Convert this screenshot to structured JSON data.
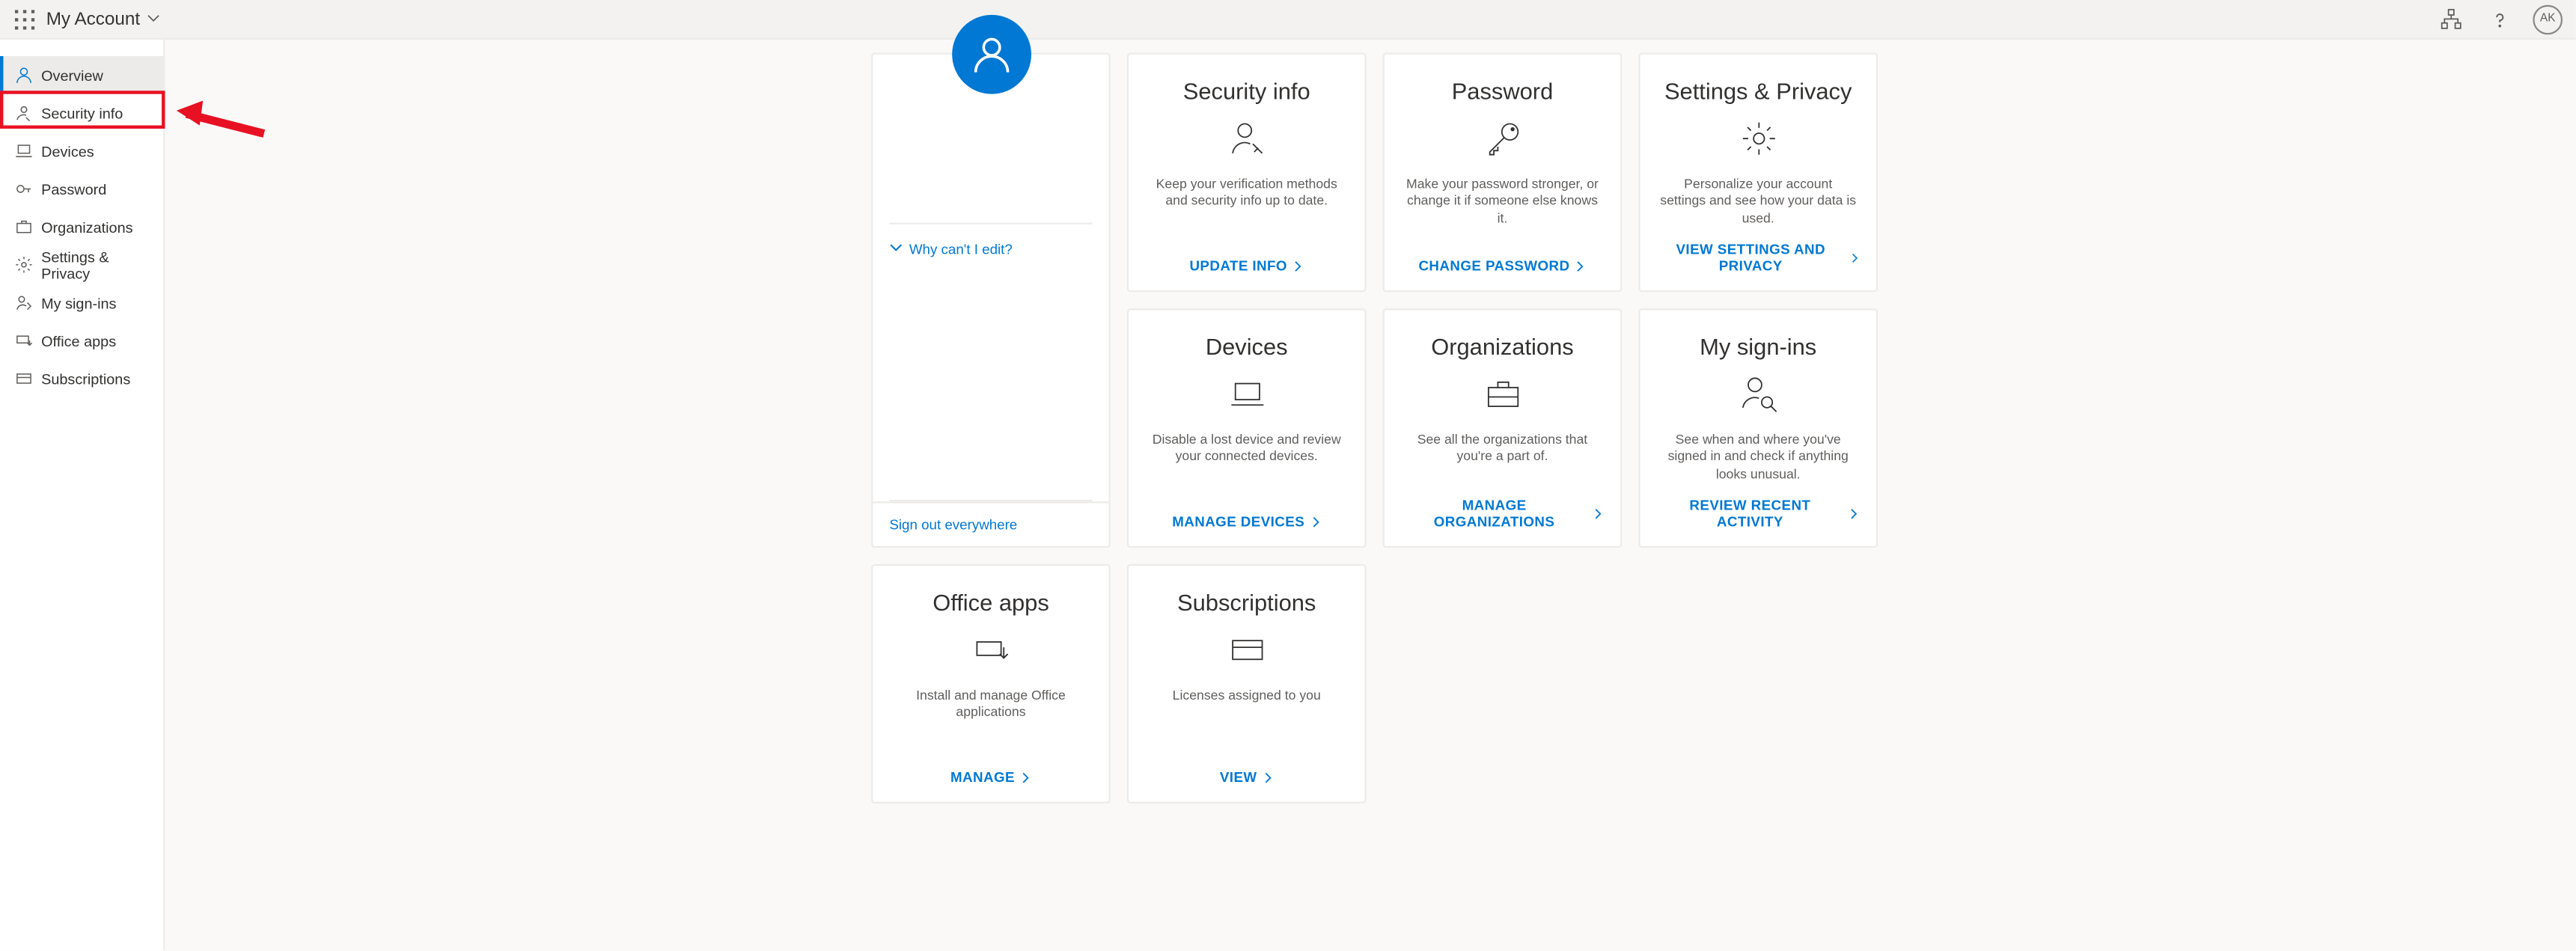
{
  "header": {
    "app_title": "My Account",
    "avatar_initials": "AK"
  },
  "sidebar": {
    "items": [
      {
        "label": "Overview"
      },
      {
        "label": "Security info"
      },
      {
        "label": "Devices"
      },
      {
        "label": "Password"
      },
      {
        "label": "Organizations"
      },
      {
        "label": "Settings & Privacy"
      },
      {
        "label": "My sign-ins"
      },
      {
        "label": "Office apps"
      },
      {
        "label": "Subscriptions"
      }
    ]
  },
  "profile": {
    "why_edit": "Why can't I edit?",
    "signout": "Sign out everywhere"
  },
  "cards": {
    "security_info": {
      "title": "Security info",
      "desc": "Keep your verification methods and security info up to date.",
      "action": "UPDATE INFO"
    },
    "password": {
      "title": "Password",
      "desc": "Make your password stronger, or change it if someone else knows it.",
      "action": "CHANGE PASSWORD"
    },
    "settings_privacy": {
      "title": "Settings & Privacy",
      "desc": "Personalize your account settings and see how your data is used.",
      "action": "VIEW SETTINGS AND PRIVACY"
    },
    "devices": {
      "title": "Devices",
      "desc": "Disable a lost device and review your connected devices.",
      "action": "MANAGE DEVICES"
    },
    "organizations": {
      "title": "Organizations",
      "desc": "See all the organizations that you're a part of.",
      "action": "MANAGE ORGANIZATIONS"
    },
    "my_signins": {
      "title": "My sign-ins",
      "desc": "See when and where you've signed in and check if anything looks unusual.",
      "action": "REVIEW RECENT ACTIVITY"
    },
    "office_apps": {
      "title": "Office apps",
      "desc": "Install and manage Office applications",
      "action": "MANAGE"
    },
    "subscriptions": {
      "title": "Subscriptions",
      "desc": "Licenses assigned to you",
      "action": "VIEW"
    }
  }
}
